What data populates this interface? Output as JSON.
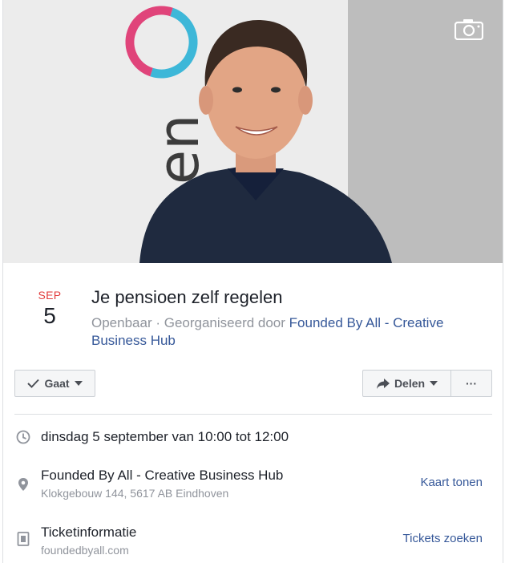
{
  "event": {
    "month": "SEP",
    "day": "5",
    "title": "Je pensioen zelf regelen",
    "meta_prefix": "Openbaar · Georganiseerd door ",
    "organizer": "Founded By All - Creative Business Hub"
  },
  "actions": {
    "going_label": "Gaat",
    "share_label": "Delen",
    "more_label": "···"
  },
  "details": {
    "datetime": "dinsdag 5 september van 10:00 tot 12:00",
    "location_name": "Founded By All - Creative Business Hub",
    "location_address": "Klokgebouw 144, 5617 AB Eindhoven",
    "map_link": "Kaart tonen",
    "ticket_title": "Ticketinformatie",
    "ticket_site": "foundedbyall.com",
    "ticket_link": "Tickets zoeken"
  },
  "cover": {
    "banner_text": "en"
  },
  "colors": {
    "month_red": "#e23e3e",
    "link_blue": "#365899",
    "muted_gray": "#90949c"
  },
  "icons": [
    "camera-icon",
    "check-icon",
    "share-arrow-icon",
    "clock-icon",
    "location-pin-icon",
    "ticket-icon"
  ]
}
